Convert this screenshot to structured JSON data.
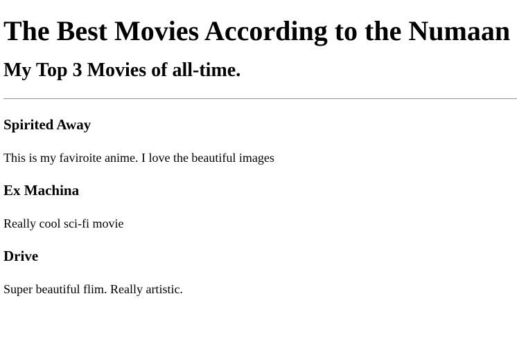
{
  "page": {
    "title": "The Best Movies According to the Numaan",
    "subtitle": "My Top 3 Movies of all-time."
  },
  "movies": [
    {
      "title": "Spirited Away",
      "description": "This is my faviroite anime. I love the beautiful images"
    },
    {
      "title": "Ex Machina",
      "description": "Really cool sci-fi movie"
    },
    {
      "title": "Drive",
      "description": "Super beautiful flim. Really artistic."
    }
  ]
}
